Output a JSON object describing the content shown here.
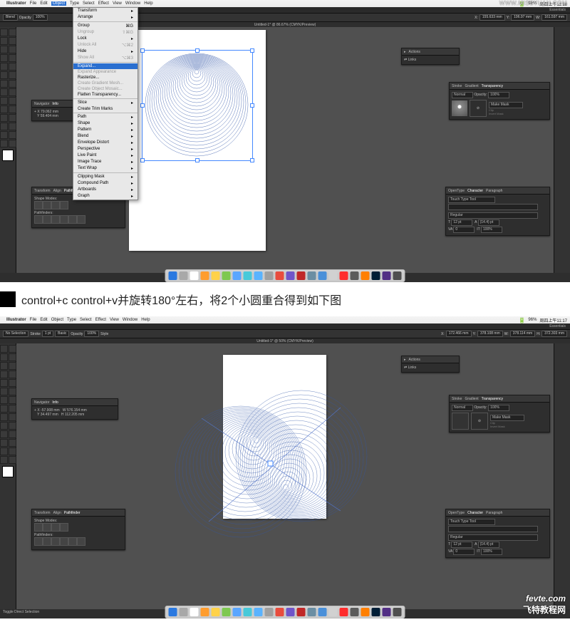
{
  "domain": "Document",
  "caption": "control+c control+v并旋转180°左右，将2个小圆重合得到如下图",
  "watermarks": {
    "top_right": "WWW.MISSYUAN.COM",
    "bottom_line1": "fevte.com",
    "bottom_line2": "飞特教程网"
  },
  "mac_menu": {
    "app": "Illustrator",
    "items": [
      "File",
      "Edit",
      "Object",
      "Type",
      "Select",
      "Effect",
      "View",
      "Window",
      "Help"
    ],
    "right1": [
      "96%",
      "周四上午11:18"
    ],
    "right2": [
      "96%",
      "周四上午11:17"
    ]
  },
  "titlebar": {
    "right": "Essentials"
  },
  "ctrlbar1": [
    "Blend",
    "Opacity",
    "100%",
    "X:",
    "155.633 mm",
    "Y:",
    "196.97 mm",
    "W:",
    "161.597 mm"
  ],
  "ctrlbar2": [
    "No Selection",
    "Stroke",
    "1 pt",
    "Basic",
    "Opacity",
    "100%",
    "Style",
    "X:",
    "172.466 mm",
    "Y:",
    "378.108 mm",
    "W:",
    "378.114 mm",
    "H:",
    "372.303 mm"
  ],
  "doc_tab1": "Untitled-1* @ 86.67% (CMYK/Preview)",
  "doc_tab2": "Untitled-1* @ 50% (CMYK/Preview)",
  "status2": "Toggle Direct Selection",
  "actions_panel": {
    "tab": "Actions",
    "link": "Links"
  },
  "transparency_panel": {
    "tabs": [
      "Stroke",
      "Gradient",
      "Transparency"
    ],
    "mode": "Normal",
    "opacity_lbl": "Opacity:",
    "opacity": "100%",
    "make_mask": "Make Mask",
    "clip": "Clip",
    "invert": "Invert Mask"
  },
  "nav_panel": {
    "tabs": [
      "Navigator",
      "Info"
    ],
    "x_label": "X",
    "y_label": "Y",
    "w_label": "W",
    "h_label": "H",
    "s1_x": "79.062 mm",
    "s1_y": "59.404 mm",
    "s2_x": "-57.908 mm",
    "s2_y": "34.497 mm",
    "s2_w": "576.154 mm",
    "s2_h": "112.205 mm"
  },
  "tap_panel": {
    "tabs": [
      "Transform",
      "Align",
      "Pathfinder"
    ],
    "shape_modes": "Shape Modes:",
    "pathfinders": "Pathfinders:"
  },
  "char_panel": {
    "tabs": [
      "OpenType",
      "Character",
      "Paragraph"
    ],
    "touch": "Touch Type Tool",
    "style": "Regular",
    "size": "12 pt",
    "leading": "(14.4) pt",
    "opt": "100%"
  },
  "object_menu": {
    "items": [
      {
        "t": "Transform",
        "arrow": true
      },
      {
        "t": "Arrange",
        "arrow": true
      },
      {
        "sep": true
      },
      {
        "t": "Group",
        "k": "⌘G"
      },
      {
        "t": "Ungroup",
        "k": "⇧⌘G",
        "dis": true
      },
      {
        "t": "Lock",
        "arrow": true
      },
      {
        "t": "Unlock All",
        "k": "⌥⌘2",
        "dis": true
      },
      {
        "t": "Hide",
        "arrow": true
      },
      {
        "t": "Show All",
        "k": "⌥⌘3",
        "dis": true
      },
      {
        "sep": true
      },
      {
        "t": "Expand...",
        "sel": true
      },
      {
        "t": "Expand Appearance",
        "dis": true
      },
      {
        "t": "Rasterize..."
      },
      {
        "t": "Create Gradient Mesh...",
        "dis": true
      },
      {
        "t": "Create Object Mosaic...",
        "dis": true
      },
      {
        "t": "Flatten Transparency..."
      },
      {
        "sep": true
      },
      {
        "t": "Slice",
        "arrow": true
      },
      {
        "t": "Create Trim Marks"
      },
      {
        "sep": true
      },
      {
        "t": "Path",
        "arrow": true
      },
      {
        "t": "Shape",
        "arrow": true
      },
      {
        "t": "Pattern",
        "arrow": true
      },
      {
        "t": "Blend",
        "arrow": true
      },
      {
        "t": "Envelope Distort",
        "arrow": true
      },
      {
        "t": "Perspective",
        "arrow": true
      },
      {
        "t": "Live Paint",
        "arrow": true
      },
      {
        "t": "Image Trace",
        "arrow": true
      },
      {
        "t": "Text Wrap",
        "arrow": true
      },
      {
        "sep": true
      },
      {
        "t": "Clipping Mask",
        "arrow": true
      },
      {
        "t": "Compound Path",
        "arrow": true
      },
      {
        "t": "Artboards",
        "arrow": true
      },
      {
        "t": "Graph",
        "arrow": true
      }
    ]
  },
  "dock_colors": [
    "#2b79e0",
    "#a8a8a8",
    "#fff",
    "#ff9d2e",
    "#ffd24a",
    "#7ec850",
    "#5aa6ff",
    "#48c9d9",
    "#5ab3ff",
    "#a0a0a0",
    "#e84c3d",
    "#7055c9",
    "#c02828",
    "#6b8ea3",
    "#4a90d9",
    "#d1d1d1",
    "#ff2d2d",
    "#5b5b5b",
    "#ff7f00",
    "#001e36",
    "#522f85",
    "#4f4f4f"
  ]
}
